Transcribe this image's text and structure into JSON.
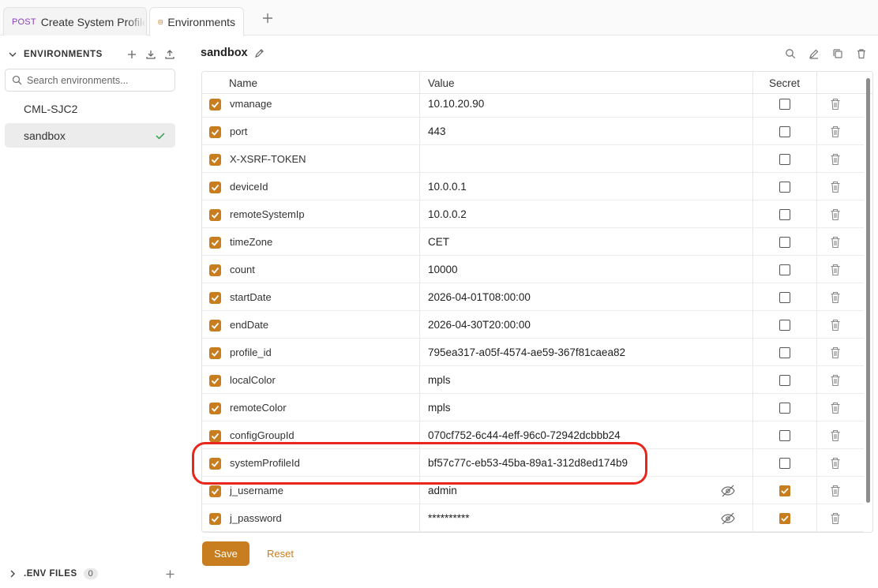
{
  "tabs": [
    {
      "method": "POST",
      "label": "Create System Profile"
    },
    {
      "label": "Environments"
    }
  ],
  "sidebar": {
    "title": "ENVIRONMENTS",
    "search_placeholder": "Search environments...",
    "items": [
      {
        "label": "CML-SJC2",
        "selected": false
      },
      {
        "label": "sandbox",
        "selected": true
      }
    ],
    "footer": {
      "title": ".ENV FILES",
      "count": "0"
    }
  },
  "environment": {
    "name": "sandbox"
  },
  "table": {
    "headers": {
      "name": "Name",
      "value": "Value",
      "secret": "Secret"
    },
    "rows": [
      {
        "enabled": true,
        "name": "vmanage",
        "value": "10.10.20.90",
        "secret": false
      },
      {
        "enabled": true,
        "name": "port",
        "value": "443",
        "secret": false
      },
      {
        "enabled": true,
        "name": "X-XSRF-TOKEN",
        "value": "",
        "secret": false
      },
      {
        "enabled": true,
        "name": "deviceId",
        "value": "10.0.0.1",
        "secret": false
      },
      {
        "enabled": true,
        "name": "remoteSystemIp",
        "value": "10.0.0.2",
        "secret": false
      },
      {
        "enabled": true,
        "name": "timeZone",
        "value": "CET",
        "secret": false
      },
      {
        "enabled": true,
        "name": "count",
        "value": "10000",
        "secret": false
      },
      {
        "enabled": true,
        "name": "startDate",
        "value": "2026-04-01T08:00:00",
        "secret": false
      },
      {
        "enabled": true,
        "name": "endDate",
        "value": "2026-04-30T20:00:00",
        "secret": false
      },
      {
        "enabled": true,
        "name": "profile_id",
        "value": "795ea317-a05f-4574-ae59-367f81caea82",
        "secret": false
      },
      {
        "enabled": true,
        "name": "localColor",
        "value": "mpls",
        "secret": false
      },
      {
        "enabled": true,
        "name": "remoteColor",
        "value": "mpls",
        "secret": false
      },
      {
        "enabled": true,
        "name": "configGroupId",
        "value": "070cf752-6c44-4eff-96c0-72942dcbbb24",
        "secret": false
      },
      {
        "enabled": true,
        "name": "systemProfileId",
        "value": "bf57c77c-eb53-45ba-89a1-312d8ed174b9",
        "secret": false
      },
      {
        "enabled": true,
        "name": "j_username",
        "value": "admin",
        "secret": true
      },
      {
        "enabled": true,
        "name": "j_password",
        "value": "**********",
        "secret": true
      }
    ]
  },
  "buttons": {
    "save": "Save",
    "reset": "Reset"
  },
  "colors": {
    "accent": "#c87d1e",
    "highlight": "#e8261c",
    "method_post": "#8a3fb8"
  }
}
